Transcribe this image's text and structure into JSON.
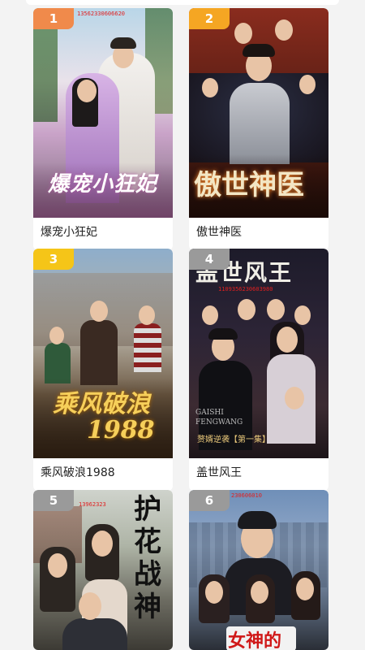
{
  "items": [
    {
      "rank": "1",
      "title": "爆宠小狂妃",
      "watermark": "13562330606620",
      "rank_color": "#f08a4b",
      "poster_title": "爆宠小狂妃"
    },
    {
      "rank": "2",
      "title": "傲世神医",
      "watermark": "",
      "rank_color": "#f5a623",
      "poster_title": "傲世神医"
    },
    {
      "rank": "3",
      "title": "乘风破浪1988",
      "watermark": "",
      "rank_color": "#f5c518",
      "poster_title": "乘风破浪",
      "poster_subtitle": "1988"
    },
    {
      "rank": "4",
      "title": "盖世风王",
      "watermark": "1109356230603980",
      "rank_color": "#9a9a9a",
      "poster_title": "盖世风王",
      "poster_en": "GAISHI FENGWANG",
      "poster_tag": "赘婿逆袭【第一集】"
    },
    {
      "rank": "5",
      "title": "",
      "watermark": "13962323",
      "rank_color": "#9a9a9a",
      "poster_title": "护花战神"
    },
    {
      "rank": "6",
      "title": "",
      "watermark": "230606010",
      "rank_color": "#9a9a9a",
      "poster_title": "女神的"
    }
  ]
}
